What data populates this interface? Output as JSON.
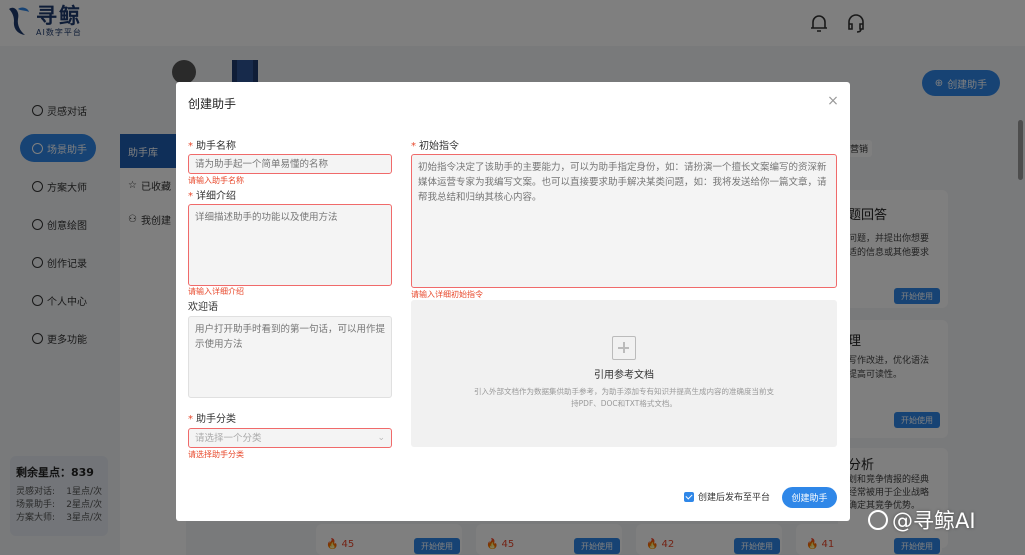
{
  "app": {
    "logo_text": "寻鲸",
    "logo_sub": "AI数字平台",
    "colors": {
      "accent": "#2f87e8",
      "error": "#e8492c",
      "brand": "#1e3a6e"
    }
  },
  "header": {
    "icons": [
      "bell-icon",
      "headset-icon"
    ]
  },
  "sidebar": {
    "items": [
      {
        "label": "灵感对话"
      },
      {
        "label": "场景助手"
      },
      {
        "label": "方案大师"
      },
      {
        "label": "创意绘图"
      },
      {
        "label": "创作记录"
      },
      {
        "label": "个人中心"
      },
      {
        "label": "更多功能"
      }
    ],
    "stars": {
      "title": "剩余星点：839",
      "lines": [
        {
          "name": "灵感对话:",
          "cost": "1星点/次"
        },
        {
          "name": "场景助手:",
          "cost": "2星点/次"
        },
        {
          "name": "方案大师:",
          "cost": "3星点/次"
        }
      ]
    }
  },
  "subnav": {
    "items": [
      {
        "label": "助手库"
      },
      {
        "label": "已收藏"
      },
      {
        "label": "我创建"
      }
    ]
  },
  "main": {
    "create_button": "创建助手",
    "tab_fragment": "营销",
    "cards": [
      {
        "title": "题回答",
        "desc": "问题，并提出你想要\n适的信息或其他要求",
        "button": "开始使用"
      },
      {
        "title": "理",
        "desc": "写作改进，优化语法\n提高可读性。",
        "button": "开始使用"
      },
      {
        "title": "分析",
        "desc": "划和竞争情报的经典\n经常被用于企业战略\n确定其竞争优势。",
        "button": "开始使用"
      }
    ],
    "bottom_counts": [
      "45",
      "45",
      "42",
      "41"
    ],
    "bottom_button": "开始使用"
  },
  "modal": {
    "title": "创建助手",
    "name": {
      "label": "助手名称",
      "placeholder": "请为助手起一个简单易懂的名称",
      "error": "请输入助手名称"
    },
    "detail": {
      "label": "详细介绍",
      "placeholder": "详细描述助手的功能以及使用方法",
      "error": "请输入详细介绍"
    },
    "welcome": {
      "label": "欢迎语",
      "placeholder": "用户打开助手时看到的第一句话，可以用作提示使用方法"
    },
    "category": {
      "label": "助手分类",
      "placeholder": "请选择一个分类",
      "error": "请选择助手分类"
    },
    "prompt": {
      "label": "初始指令",
      "placeholder": "初始指令决定了该助手的主要能力，可以为助手指定身份，如：请扮演一个擅长文案编写的资深新媒体运营专家为我编写文案。也可以直接要求助手解决某类问题，如：我将发送给你一篇文章，请帮我总结和归纳其核心内容。",
      "error": "请输入详细初始指令"
    },
    "reference": {
      "title": "引用参考文档",
      "desc": "引入外部文档作为数据集供助手参考，为助手添加专有知识并提高生成内容的准确度当前支持PDF、DOC和TXT格式文档。"
    },
    "publish_label": "创建后发布至平台",
    "publish_checked": true,
    "submit_label": "创建助手"
  },
  "watermark": "@寻鲸AI"
}
